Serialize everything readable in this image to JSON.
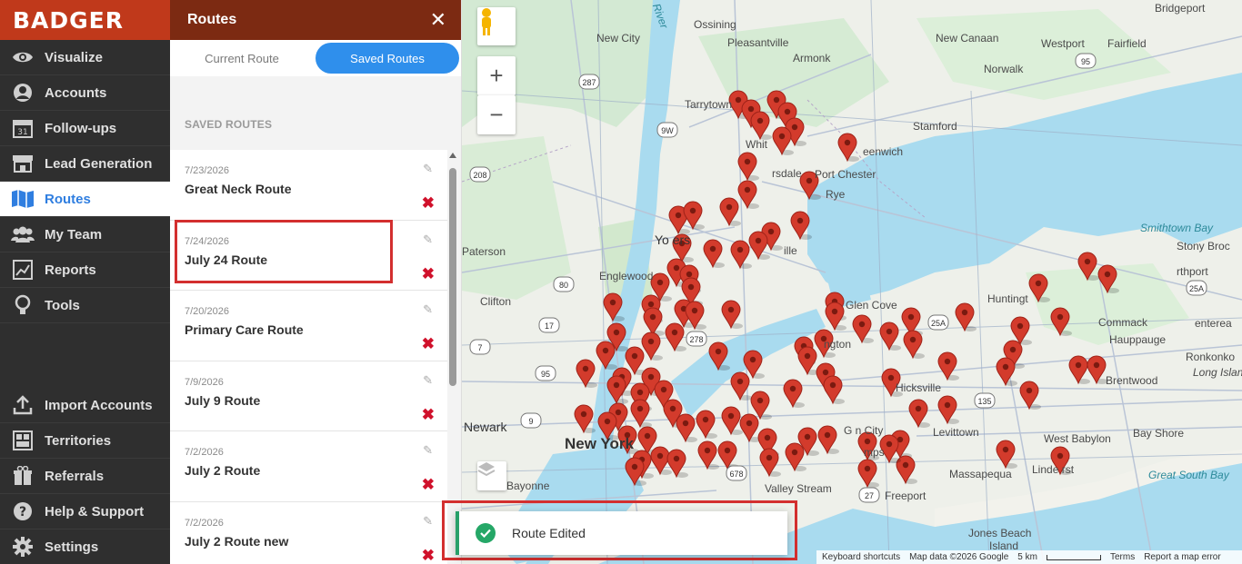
{
  "app": {
    "logo": "BADGER"
  },
  "nav": {
    "items": [
      {
        "label": "Visualize",
        "icon": "eye-icon"
      },
      {
        "label": "Accounts",
        "icon": "user-icon"
      },
      {
        "label": "Follow-ups",
        "icon": "calendar-icon"
      },
      {
        "label": "Lead Generation",
        "icon": "store-icon"
      },
      {
        "label": "Routes",
        "icon": "map-icon",
        "active": true
      },
      {
        "label": "My Team",
        "icon": "team-icon"
      },
      {
        "label": "Reports",
        "icon": "chart-icon"
      },
      {
        "label": "Tools",
        "icon": "lightbulb-icon"
      }
    ],
    "bottom": [
      {
        "label": "Import Accounts",
        "icon": "upload-icon"
      },
      {
        "label": "Territories",
        "icon": "territories-icon"
      },
      {
        "label": "Referrals",
        "icon": "gift-icon"
      },
      {
        "label": "Help & Support",
        "icon": "help-icon"
      },
      {
        "label": "Settings",
        "icon": "gear-icon"
      }
    ]
  },
  "panel": {
    "title": "Routes",
    "tabs": {
      "current": "Current Route",
      "saved": "Saved Routes"
    },
    "saved_title": "SAVED ROUTES",
    "routes": [
      {
        "date": "7/23/2026",
        "name": "Great Neck Route"
      },
      {
        "date": "7/24/2026",
        "name": "July 24 Route"
      },
      {
        "date": "7/20/2026",
        "name": "Primary Care Route"
      },
      {
        "date": "7/9/2026",
        "name": "July 9 Route"
      },
      {
        "date": "7/2/2026",
        "name": "July 2 Route"
      },
      {
        "date": "7/2/2026",
        "name": "July 2 Route new"
      }
    ]
  },
  "toast": {
    "message": "Route Edited"
  },
  "map": {
    "labels": {
      "bridgeport": "Bridgeport",
      "ossining": "Ossining",
      "new_city": "New City",
      "pleasantville": "Pleasantville",
      "armonk": "Armonk",
      "new_canaan": "New Canaan",
      "westport": "Westport",
      "fairfield": "Fairfield",
      "norwalk": "Norwalk",
      "tarrytown": "Tarrytown",
      "stamford": "Stamford",
      "greenwich": "eenwich",
      "port_chester": "Port Chester",
      "rye": "Rye",
      "white_plains": "Whit",
      "scarsdale": "rsdale",
      "yonkers": "Yo  ers",
      "paterson": "Paterson",
      "englewood": "Englewood",
      "clifton": "Clifton",
      "glen_cove": "Glen Cove",
      "huntington": "Huntingt",
      "commack": "Commack",
      "northport": "rthport",
      "smithtown_bay": "Smithtown Bay",
      "stony_brook": "Stony Broc",
      "centereach": "enterea",
      "hauppauge": "Hauppauge",
      "ronkonkoma": "Ronkonko",
      "long_island": "Long Islan",
      "brentwood": "Brentwood",
      "hicksville": "Hicksville",
      "levittown": "Levittown",
      "west_babylon": "West Babylon",
      "bay_shore": "Bay Shore",
      "great_south_bay": "Great South Bay",
      "massapequa": "Massapequa",
      "lindenhurst": "Linde    rst",
      "newark": "Newark",
      "new_york": "New York",
      "bayonne": "Bayonne",
      "valley_stream": "Valley Stream",
      "freeport": "Freeport",
      "garden_city": "G  n City",
      "hempstead": "mps",
      "jones_beach": "Jones Beach",
      "island": "Island",
      "rivington": "ngton",
      "ille": "ille",
      "river": "River"
    },
    "road_signs": [
      "287",
      "9W",
      "208",
      "17",
      "80",
      "95",
      "278",
      "678",
      "9",
      "135",
      "27",
      "25A",
      "25A",
      "95",
      "7"
    ],
    "attribution": {
      "shortcuts": "Keyboard shortcuts",
      "data": "Map data ©2026 Google",
      "scale": "5 km",
      "terms": "Terms",
      "report": "Report a map error"
    }
  }
}
